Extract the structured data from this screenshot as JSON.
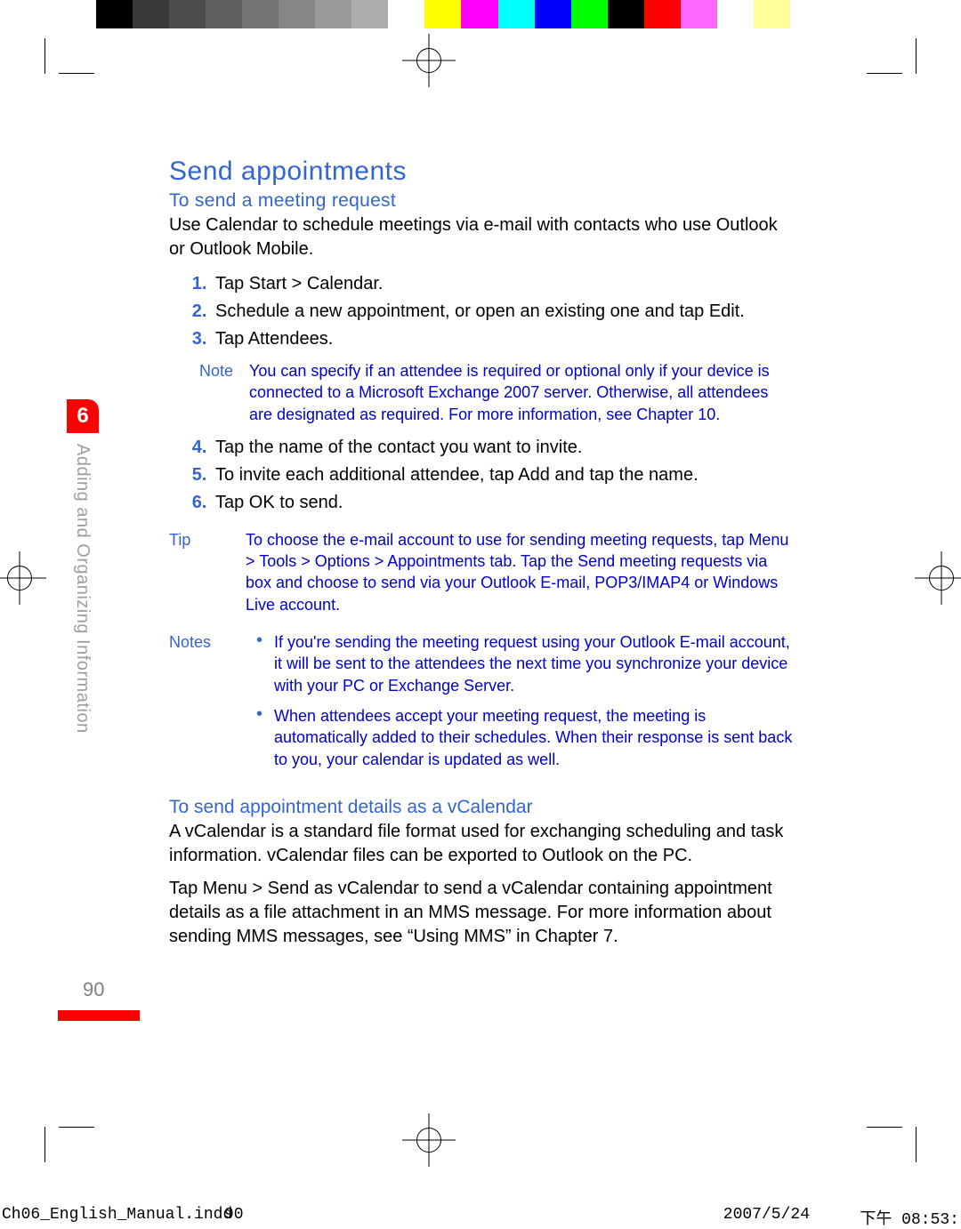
{
  "colorbar": [
    "#000000",
    "#3a3a3a",
    "#4d4d4d",
    "#606060",
    "#737373",
    "#868686",
    "#9a9a9a",
    "#adadad",
    "#ffffff",
    "#ffff00",
    "#ff00ff",
    "#00ffff",
    "#0000ff",
    "#00ff00",
    "#000000",
    "#ff0000",
    "#ff66ff",
    "#ffffff",
    "#ffff99"
  ],
  "chapter_number": "6",
  "side_label": "Adding and Organizing Information",
  "page_number": "90",
  "section_title": "Send appointments",
  "sub1_title": "To send a meeting request",
  "intro1": "Use Calendar to schedule meetings via e-mail with contacts who use Outlook or Outlook Mobile.",
  "steps_a": [
    "Tap Start > Calendar.",
    "Schedule a new appointment, or open an existing one and tap Edit.",
    "Tap Attendees."
  ],
  "note1_label": "Note",
  "note1_text": "You can specify if an attendee is required or optional only if your device is connected to a Microsoft Exchange 2007 server. Otherwise, all attendees are designated as required. For more information, see Chapter 10.",
  "steps_b": [
    "Tap the name of the contact you want to invite.",
    "To invite each additional attendee, tap Add and tap the name.",
    "Tap OK to send."
  ],
  "tip_label": "Tip",
  "tip_text": "To choose the e-mail account to use for sending meeting requests, tap Menu > Tools > Options > Appointments tab. Tap the Send meeting requests via box and choose to send via your Outlook E-mail, POP3/IMAP4 or Windows Live account.",
  "notes_label": "Notes",
  "notes_items": [
    "If you're sending the meeting request using your Outlook E-mail account, it will be sent to the attendees the next time you synchronize your device with your PC or Exchange Server.",
    "When attendees accept your meeting request, the meeting is automatically added to their schedules. When their response is sent back to you, your calendar is updated as well."
  ],
  "sub2_title": "To send appointment details as a vCalendar",
  "vcal_para1": "A vCalendar is a standard file format used for exchanging scheduling and task information. vCalendar files can be exported to Outlook on the PC.",
  "vcal_para2": "Tap Menu > Send as vCalendar to send a vCalendar containing appointment details as a file attachment in an MMS message. For more information about sending MMS messages, see “Using MMS” in Chapter 7.",
  "slug": {
    "file": "Ch06_English_Manual.indd",
    "page": "90",
    "date": "2007/5/24",
    "time": "下午 08:53:"
  }
}
